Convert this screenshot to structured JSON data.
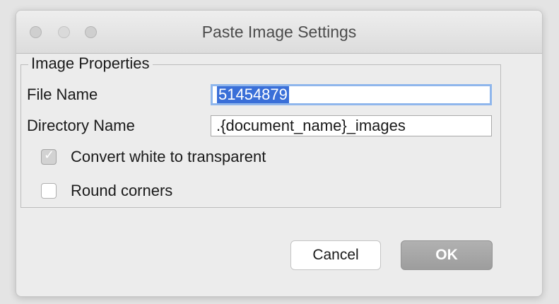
{
  "window": {
    "title": "Paste Image Settings"
  },
  "group": {
    "legend": "Image Properties"
  },
  "fields": {
    "file_name_label": "File Name",
    "file_name_value": "51454879",
    "directory_name_label": "Directory Name",
    "directory_name_value": ".{document_name}_images"
  },
  "options": {
    "convert_white_label": "Convert white to transparent",
    "convert_white_checked": true,
    "round_corners_label": "Round corners",
    "round_corners_checked": false
  },
  "buttons": {
    "cancel_label": "Cancel",
    "ok_label": "OK"
  },
  "colors": {
    "selection": "#3a6fd8",
    "focus_ring": "#8fb6ec",
    "ok_button": "#a8a8a8"
  },
  "icons": {
    "close": "close-icon",
    "minimize": "minimize-icon",
    "zoom": "zoom-icon",
    "checkmark": "checkmark-icon"
  }
}
